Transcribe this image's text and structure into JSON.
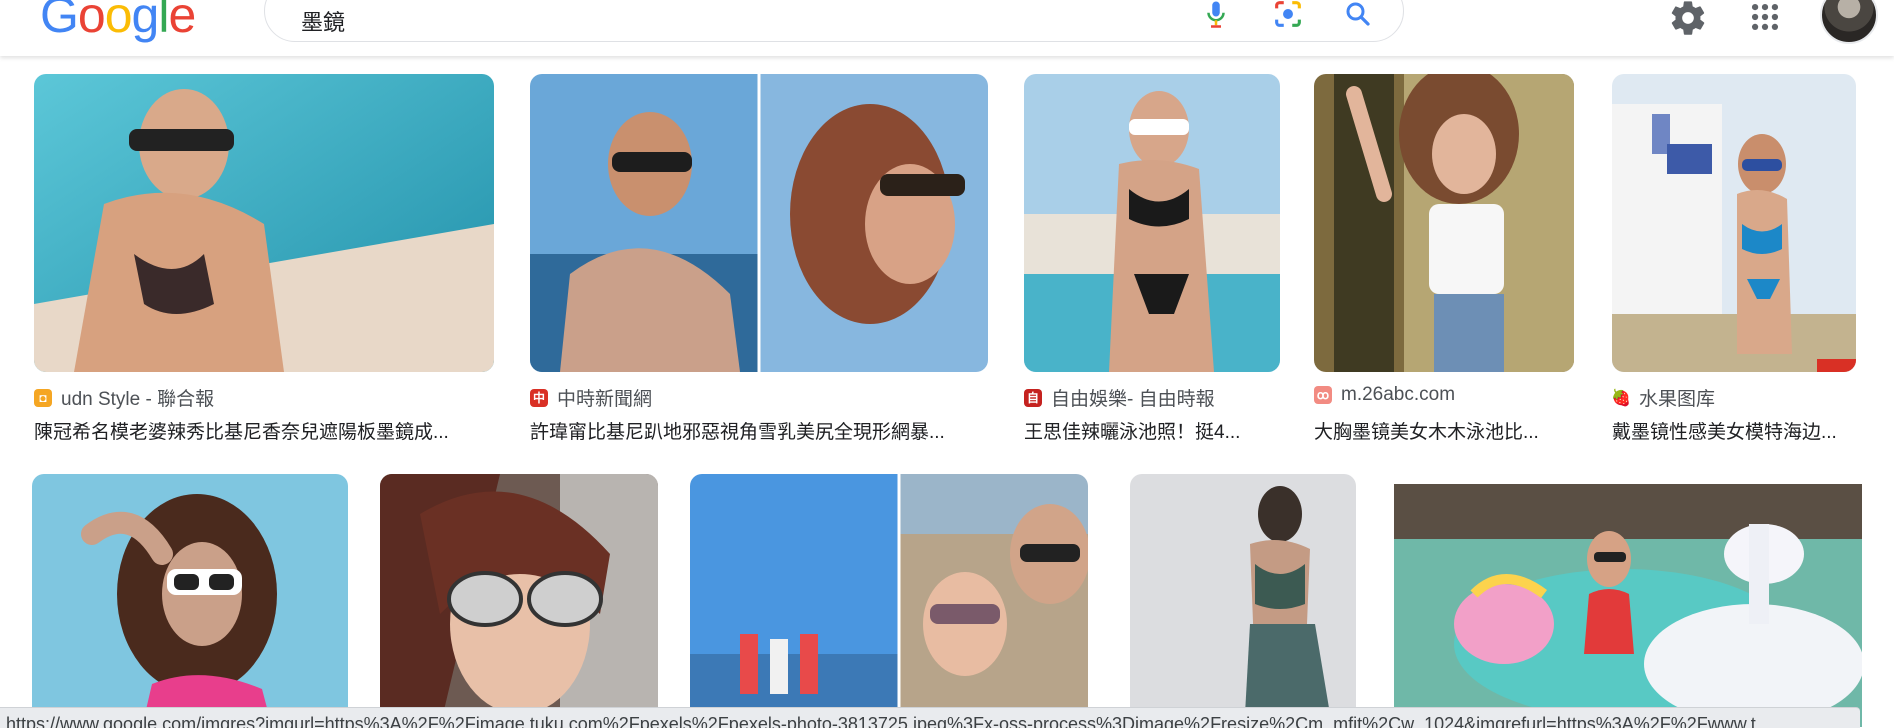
{
  "header": {
    "logo": "Google",
    "search_query": "墨鏡",
    "icons": [
      "mic-icon",
      "camera-icon",
      "search-icon",
      "settings-icon",
      "apps-icon",
      "avatar"
    ]
  },
  "results": [
    {
      "source": "udn Style - 聯合報",
      "caption": "陳冠希名模老婆辣秀比基尼香奈兒遮陽板墨鏡成...",
      "favicon_color": "#f5a623"
    },
    {
      "source": "中時新聞網",
      "caption": "許瑋甯比基尼趴地邪惡視角雪乳美尻全現形網暴...",
      "favicon_color": "#d93025"
    },
    {
      "source": "自由娛樂- 自由時報",
      "caption": "王思佳辣曬泳池照！挺4...",
      "favicon_color": "#c5221f"
    },
    {
      "source": "m.26abc.com",
      "caption": "大胸墨镜美女木木泳池比...",
      "favicon_color": "#f28b82"
    },
    {
      "source": "水果图库",
      "caption": "戴墨镜性感美女模特海边...",
      "favicon_color": "#d93025"
    }
  ],
  "status_bar": {
    "url": "https://www.google.com/imgres?imgurl=https%3A%2F%2Fimage.tuku.com%2Fpexels%2Fpexels-photo-3813725.jpeg%3Fx-oss-process%3Dimage%2Fresize%2Cm_mfit%2Cw_1024&imgrefurl=https%3A%2F%2Fwww.t"
  },
  "colors": {
    "google_blue": "#4285f4",
    "google_red": "#ea4335",
    "google_yellow": "#fbbc05",
    "google_green": "#34a853"
  }
}
